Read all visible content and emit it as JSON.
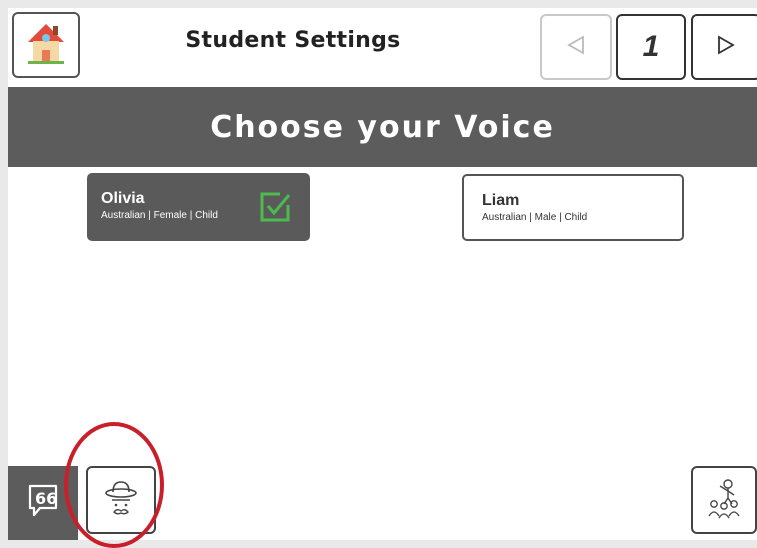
{
  "header": {
    "title": "Student Settings",
    "page_number": "1"
  },
  "banner": {
    "heading": "Choose your Voice"
  },
  "voices": [
    {
      "name": "Olivia",
      "description": "Australian | Female | Child",
      "selected": true
    },
    {
      "name": "Liam",
      "description": "Australian | Male | Child",
      "selected": false
    }
  ],
  "icons": {
    "home": "house-icon",
    "prev": "triangle-left-icon",
    "next": "triangle-right-icon",
    "check": "checkmark-icon",
    "speech": "speech-bubble-icon",
    "voice": "hat-mustache-icon",
    "group": "group-people-icon"
  },
  "colors": {
    "banner": "#5c5c5c",
    "selected_card": "#5a5a5a",
    "check": "#4cba4c",
    "highlight": "#c8202a"
  }
}
